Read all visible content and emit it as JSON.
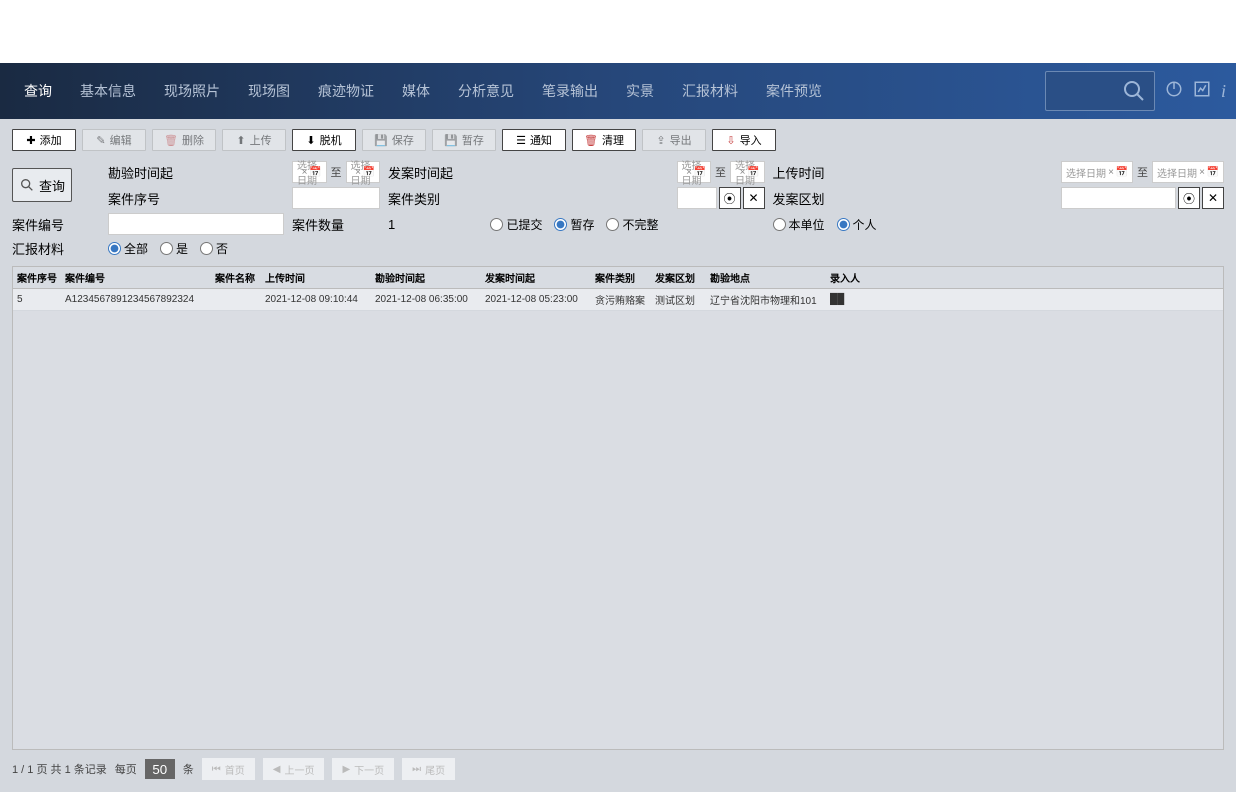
{
  "nav": {
    "items": [
      "查询",
      "基本信息",
      "现场照片",
      "现场图",
      "痕迹物证",
      "媒体",
      "分析意见",
      "笔录输出",
      "实景",
      "汇报材料",
      "案件预览"
    ],
    "active_index": 0
  },
  "toolbar": {
    "add": "添加",
    "edit": "编辑",
    "delete": "删除",
    "upload": "上传",
    "offline": "脱机",
    "save": "保存",
    "tempsave": "暂存",
    "notify": "通知",
    "clean": "清理",
    "export": "导出",
    "import": "导入"
  },
  "filters": {
    "inspect_time_label": "勘验时间起",
    "case_time_label": "发案时间起",
    "upload_time_label": "上传时间",
    "case_serial_label": "案件序号",
    "case_type_label": "案件类别",
    "case_area_label": "发案区划",
    "case_no_label": "案件编号",
    "case_count_label": "案件数量",
    "case_count_value": "1",
    "report_material_label": "汇报材料",
    "date_placeholder": "选择日期",
    "to": "至",
    "status": {
      "submitted": "已提交",
      "temp": "暂存",
      "incomplete": "不完整",
      "selected": "temp"
    },
    "scope": {
      "unit": "本单位",
      "personal": "个人",
      "selected": "personal"
    },
    "report": {
      "all": "全部",
      "yes": "是",
      "no": "否",
      "selected": "all"
    },
    "search_btn": "查询"
  },
  "table": {
    "columns": [
      "案件序号",
      "案件编号",
      "案件名称",
      "上传时间",
      "勘验时间起",
      "发案时间起",
      "案件类别",
      "发案区划",
      "勘验地点",
      "录入人"
    ],
    "rows": [
      {
        "c0": "5",
        "c1": "A1234567891234567892324",
        "c2": "",
        "c3": "2021-12-08 09:10:44",
        "c4": "2021-12-08 06:35:00",
        "c5": "2021-12-08 05:23:00",
        "c6": "贪污贿赂案",
        "c7": "测试区划",
        "c8": "辽宁省沈阳市物理和101",
        "c9": "██"
      }
    ]
  },
  "pager": {
    "info": "1 / 1 页  共 1 条记录",
    "perpage_prefix": "每页",
    "perpage_value": "50",
    "perpage_suffix": "条",
    "first": "首页",
    "prev": "上一页",
    "next": "下一页",
    "last": "尾页"
  }
}
